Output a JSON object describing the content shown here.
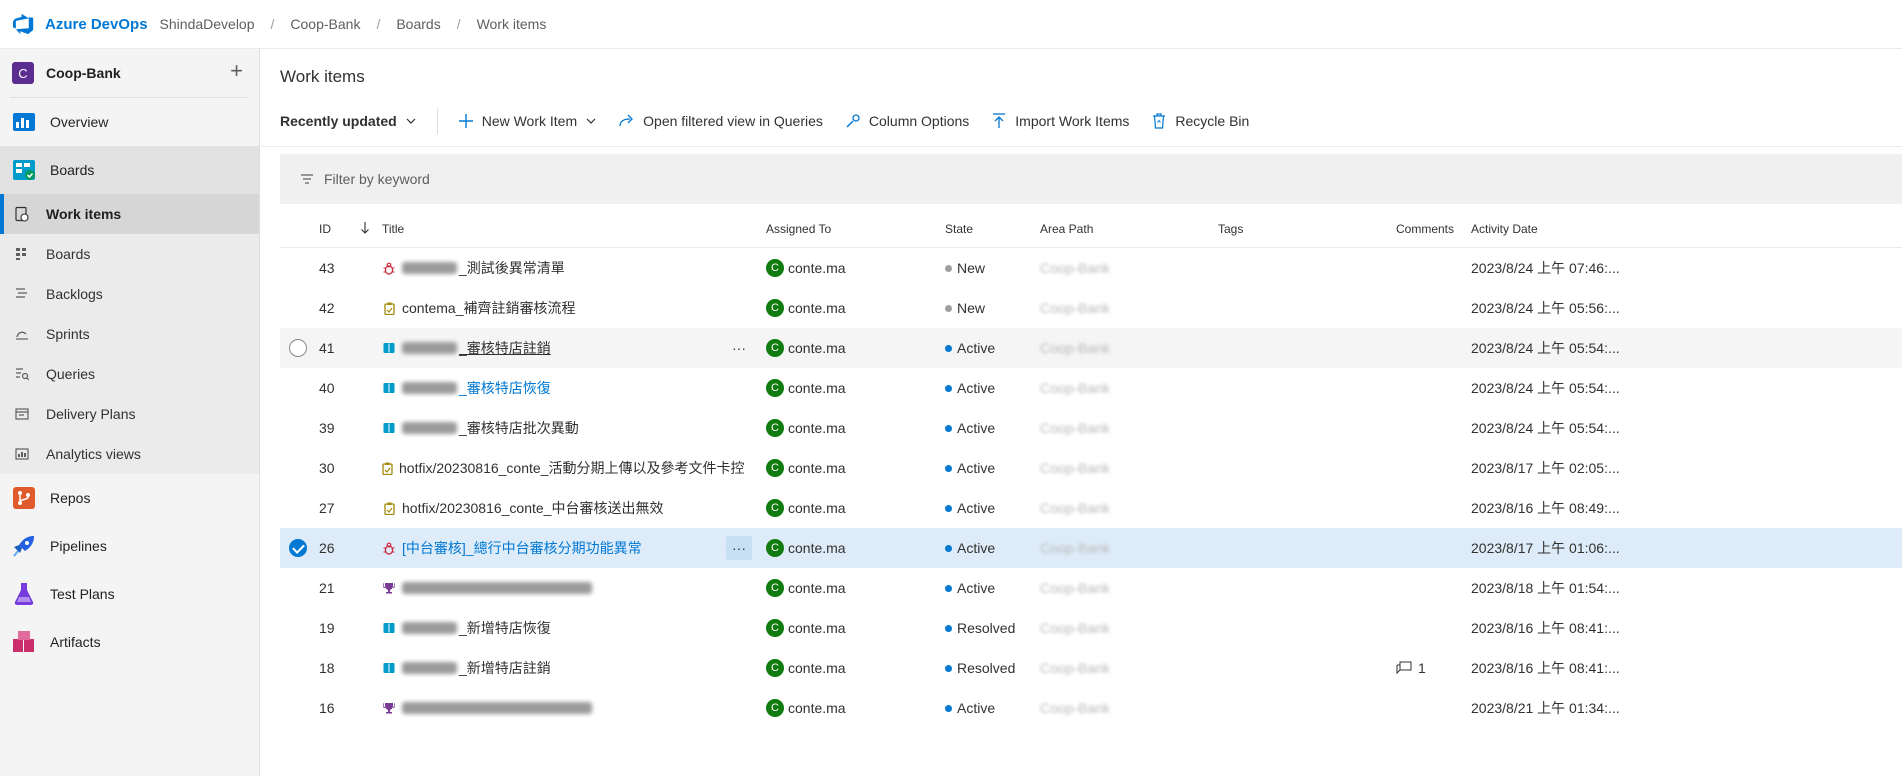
{
  "topbar": {
    "brand": "Azure DevOps",
    "breadcrumbs": [
      "ShindaDevelop",
      "Coop-Bank",
      "Boards",
      "Work items"
    ]
  },
  "sidebar": {
    "project_initial": "C",
    "project_name": "Coop-Bank",
    "items": [
      {
        "label": "Overview",
        "icon": "overview-icon",
        "color": "#0078d4"
      },
      {
        "label": "Boards",
        "icon": "boards-icon",
        "color": "#009ccc"
      },
      {
        "label": "Repos",
        "icon": "repos-icon",
        "color": "#e05b2c"
      },
      {
        "label": "Pipelines",
        "icon": "pipelines-icon",
        "color": "#2560e0"
      },
      {
        "label": "Test Plans",
        "icon": "test-plans-icon",
        "color": "#773adc"
      },
      {
        "label": "Artifacts",
        "icon": "artifacts-icon",
        "color": "#cb2e6d"
      }
    ],
    "boards_sub": [
      {
        "label": "Work items",
        "icon": "work-items-icon"
      },
      {
        "label": "Boards",
        "icon": "boards-sub-icon"
      },
      {
        "label": "Backlogs",
        "icon": "backlogs-icon"
      },
      {
        "label": "Sprints",
        "icon": "sprints-icon"
      },
      {
        "label": "Queries",
        "icon": "queries-icon"
      },
      {
        "label": "Delivery Plans",
        "icon": "delivery-plans-icon"
      },
      {
        "label": "Analytics views",
        "icon": "analytics-views-icon"
      }
    ]
  },
  "main": {
    "title": "Work items",
    "toolbar": {
      "view": "Recently updated",
      "new_work_item": "New Work Item",
      "open_in_queries": "Open filtered view in Queries",
      "column_options": "Column Options",
      "import": "Import Work Items",
      "recycle_bin": "Recycle Bin"
    },
    "filter_placeholder": "Filter by keyword",
    "columns": {
      "id": "ID",
      "title": "Title",
      "assigned": "Assigned To",
      "state": "State",
      "area": "Area Path",
      "tags": "Tags",
      "comments": "Comments",
      "date": "Activity Date"
    },
    "rows": [
      {
        "id": "43",
        "type": "bug",
        "title": "_測試後異常清單",
        "blur_prefix": true,
        "assigned": "conte.ma",
        "state": "New",
        "area": "Coop-Bank",
        "comments": "",
        "date": "2023/8/24 上午 07:46:..."
      },
      {
        "id": "42",
        "type": "task",
        "title": "contema_補齊註銷審核流程",
        "blur_prefix": false,
        "assigned": "conte.ma",
        "state": "New",
        "area": "Coop-Bank",
        "comments": "",
        "date": "2023/8/24 上午 05:56:..."
      },
      {
        "id": "41",
        "type": "story",
        "title": "_審核特店註銷",
        "blur_prefix": true,
        "assigned": "conte.ma",
        "state": "Active",
        "area": "Coop-Bank",
        "comments": "",
        "date": "2023/8/24 上午 05:54:..."
      },
      {
        "id": "40",
        "type": "story",
        "title": "_審核特店恢復",
        "blur_prefix": true,
        "assigned": "conte.ma",
        "state": "Active",
        "area": "Coop-Bank",
        "comments": "",
        "date": "2023/8/24 上午 05:54:..."
      },
      {
        "id": "39",
        "type": "story",
        "title": "_審核特店批次異動",
        "blur_prefix": true,
        "assigned": "conte.ma",
        "state": "Active",
        "area": "Coop-Bank",
        "comments": "",
        "date": "2023/8/24 上午 05:54:..."
      },
      {
        "id": "30",
        "type": "task",
        "title": "hotfix/20230816_conte_活動分期上傳以及參考文件卡控",
        "blur_prefix": false,
        "assigned": "conte.ma",
        "state": "Active",
        "area": "Coop-Bank",
        "comments": "",
        "date": "2023/8/17 上午 02:05:..."
      },
      {
        "id": "27",
        "type": "task",
        "title": "hotfix/20230816_conte_中台審核送出無效",
        "blur_prefix": false,
        "assigned": "conte.ma",
        "state": "Active",
        "area": "Coop-Bank",
        "comments": "",
        "date": "2023/8/16 上午 08:49:..."
      },
      {
        "id": "26",
        "type": "bug",
        "title": "[中台審核]_總行中台審核分期功能異常",
        "blur_prefix": false,
        "assigned": "conte.ma",
        "state": "Active",
        "area": "Coop-Bank",
        "comments": "",
        "date": "2023/8/17 上午 01:06:..."
      },
      {
        "id": "21",
        "type": "epic",
        "title": "",
        "blur_prefix": true,
        "assigned": "conte.ma",
        "state": "Active",
        "area": "Coop-Bank",
        "comments": "",
        "date": "2023/8/18 上午 01:54:..."
      },
      {
        "id": "19",
        "type": "story",
        "title": "_新增特店恢復",
        "blur_prefix": true,
        "assigned": "conte.ma",
        "state": "Resolved",
        "area": "Coop-Bank",
        "comments": "",
        "date": "2023/8/16 上午 08:41:..."
      },
      {
        "id": "18",
        "type": "story",
        "title": "_新增特店註銷",
        "blur_prefix": true,
        "assigned": "conte.ma",
        "state": "Resolved",
        "area": "Coop-Bank",
        "comments": "1",
        "date": "2023/8/16 上午 08:41:..."
      },
      {
        "id": "16",
        "type": "epic",
        "title": "",
        "blur_prefix": true,
        "assigned": "conte.ma",
        "state": "Active",
        "area": "Coop-Bank",
        "comments": "",
        "date": "2023/8/21 上午 01:34:..."
      }
    ],
    "colors": {
      "new": "#a19f9d",
      "active": "#0078d4",
      "resolved": "#0078d4",
      "bug": "#cc293d",
      "task": "#a4880a",
      "story": "#009ccc",
      "epic": "#773b93"
    }
  }
}
